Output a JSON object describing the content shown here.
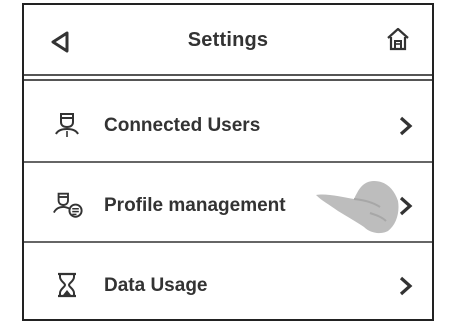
{
  "header": {
    "title": "Settings",
    "back_icon": "back-triangle-icon",
    "home_icon": "home-icon"
  },
  "menu": {
    "items": [
      {
        "label": "Connected Users",
        "icon": "user-icon"
      },
      {
        "label": "Profile management",
        "icon": "user-profile-icon"
      },
      {
        "label": "Data Usage",
        "icon": "hourglass-icon"
      }
    ]
  },
  "colors": {
    "text": "#333333",
    "border": "#222222",
    "hand_overlay": "#b9b9b9"
  }
}
